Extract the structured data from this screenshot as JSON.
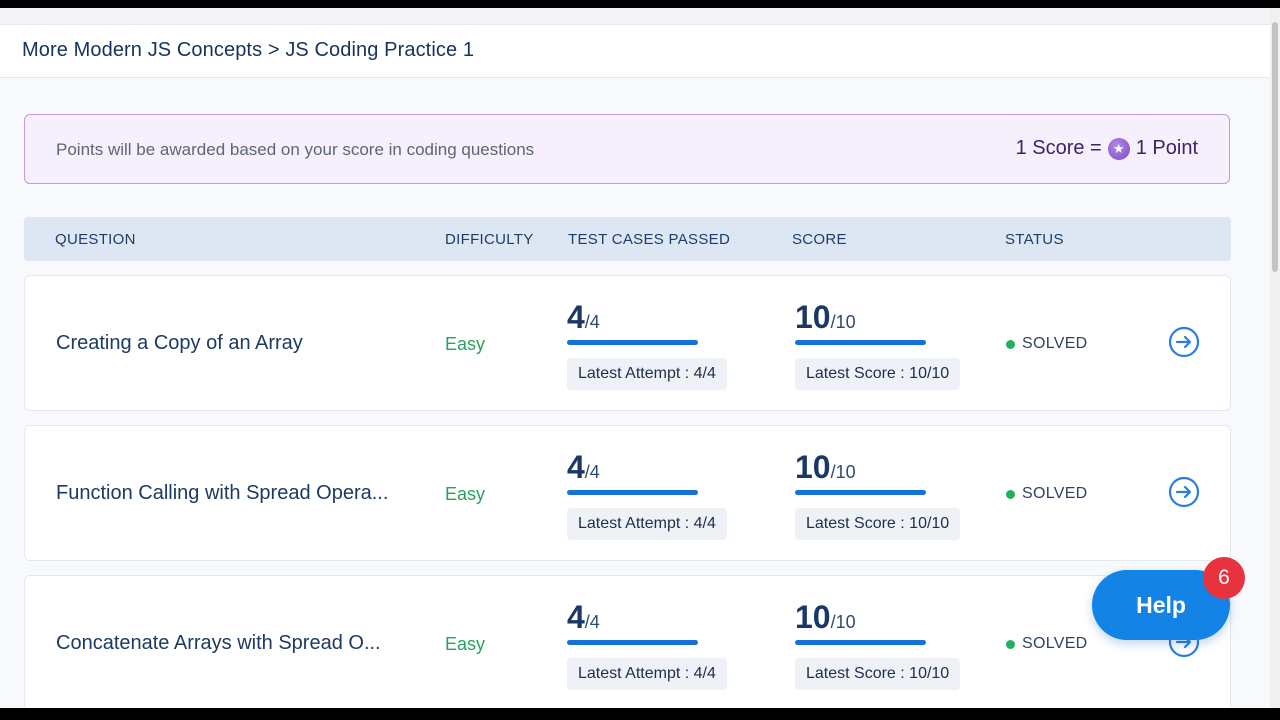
{
  "breadcrumb": {
    "course": "More Modern JS Concepts",
    "separator": ">",
    "page": "JS Coding Practice 1"
  },
  "banner": {
    "text": "Points will be awarded based on your score in coding questions",
    "score_lhs": "1 Score =",
    "score_rhs": "1 Point",
    "coin_icon": "star-coin-icon"
  },
  "table": {
    "headers": {
      "question": "QUESTION",
      "difficulty": "DIFFICULTY",
      "test_cases": "TEST CASES PASSED",
      "score": "SCORE",
      "status": "STATUS"
    },
    "rows": [
      {
        "question": "Creating a Copy of an Array",
        "difficulty": "Easy",
        "passed": "4",
        "total_cases": "/4",
        "latest_attempt": "Latest Attempt : 4/4",
        "score": "10",
        "max_score": "/10",
        "latest_score": "Latest Score : 10/10",
        "status": "SOLVED"
      },
      {
        "question": "Function Calling with Spread Opera...",
        "difficulty": "Easy",
        "passed": "4",
        "total_cases": "/4",
        "latest_attempt": "Latest Attempt : 4/4",
        "score": "10",
        "max_score": "/10",
        "latest_score": "Latest Score : 10/10",
        "status": "SOLVED"
      },
      {
        "question": "Concatenate Arrays with Spread O...",
        "difficulty": "Easy",
        "passed": "4",
        "total_cases": "/4",
        "latest_attempt": "Latest Attempt : 4/4",
        "score": "10",
        "max_score": "/10",
        "latest_score": "Latest Score : 10/10",
        "status": "SOLVED"
      }
    ]
  },
  "help": {
    "label": "Help",
    "badge_count": "6"
  },
  "colors": {
    "accent": "#1670d9",
    "solved": "#22b15b",
    "easy": "#27a35d",
    "badge": "#e8323e",
    "banner_border": "#c49ad7"
  }
}
